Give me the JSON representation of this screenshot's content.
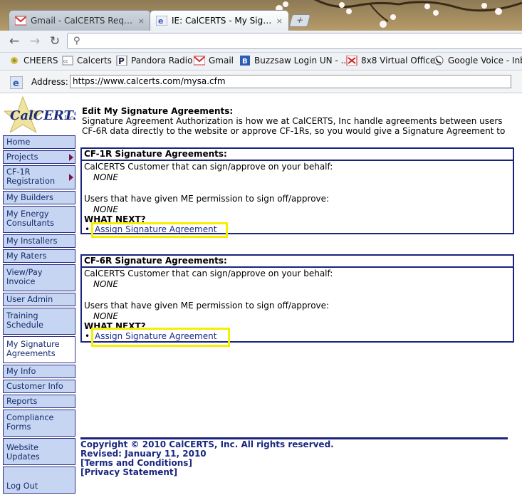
{
  "browser": {
    "tabs": [
      {
        "label": "Gmail - CalCERTS Reques...",
        "close": "×"
      },
      {
        "label": "IE: CalCERTS - My Signat...",
        "close": "×"
      }
    ],
    "new_tab": "+",
    "omnibox_value": "",
    "bookmarks": [
      "CHEERS",
      "Calcerts",
      "Pandora Radio",
      "Gmail",
      "Buzzsaw Login UN - ...",
      "8x8 Virtual Office",
      "Google Voice - Inbox"
    ],
    "address_label": "Address:",
    "address_value": "https://www.calcerts.com/mysa.cfm"
  },
  "sidebar": {
    "items": [
      {
        "label": "Home"
      },
      {
        "label": "Projects"
      },
      {
        "label": "CF-1R Registration"
      },
      {
        "label": "My Builders"
      },
      {
        "label": "My Energy Consultants"
      },
      {
        "label": "My Installers"
      },
      {
        "label": "My Raters"
      },
      {
        "label": "View/Pay Invoice"
      },
      {
        "label": "User Admin"
      },
      {
        "label": "Training Schedule"
      },
      {
        "label": "My Signature Agreements"
      },
      {
        "label": "My Info"
      },
      {
        "label": "Customer Info"
      },
      {
        "label": "Reports"
      },
      {
        "label": "Compliance Forms"
      },
      {
        "label": "Website Updates"
      },
      {
        "label": "Log Out"
      }
    ]
  },
  "main": {
    "title": "Edit My Signature Agreements:",
    "desc_line1": "Signature Agreement Authorization is how we at CalCERTS, Inc handle agreements between users",
    "desc_line2": "CF-6R data directly to the website or approve CF-1Rs, so you would give a Signature Agreement to"
  },
  "sections": [
    {
      "heading": "CF-1R Signature Agreements:",
      "customer_label": "CalCERTS Customer that can sign/approve on your behalf:",
      "customer_value": "NONE",
      "users_label": "Users that have given ME permission to sign off/approve:",
      "users_value": "NONE",
      "what_next": "WHAT NEXT?",
      "link": "Assign Signature Agreement"
    },
    {
      "heading": "CF-6R Signature Agreements:",
      "customer_label": "CalCERTS Customer that can sign/approve on your behalf:",
      "customer_value": "NONE",
      "users_label": "Users that have given ME permission to sign off/approve:",
      "users_value": "NONE",
      "what_next": "WHAT NEXT?",
      "link": "Assign Signature Agreement"
    }
  ],
  "footer": {
    "copyright": "Copyright © 2010 CalCERTS, Inc. All rights reserved.",
    "revised": "Revised: January 11, 2010",
    "terms": "[Terms and Conditions]",
    "privacy": "[Privacy Statement]"
  },
  "colors": {
    "nav_bg": "#c6d6f2",
    "nav_border": "#2c2f88",
    "box_border": "#1a237e",
    "highlight": "#f5ef00",
    "link": "#1a2a8f"
  }
}
